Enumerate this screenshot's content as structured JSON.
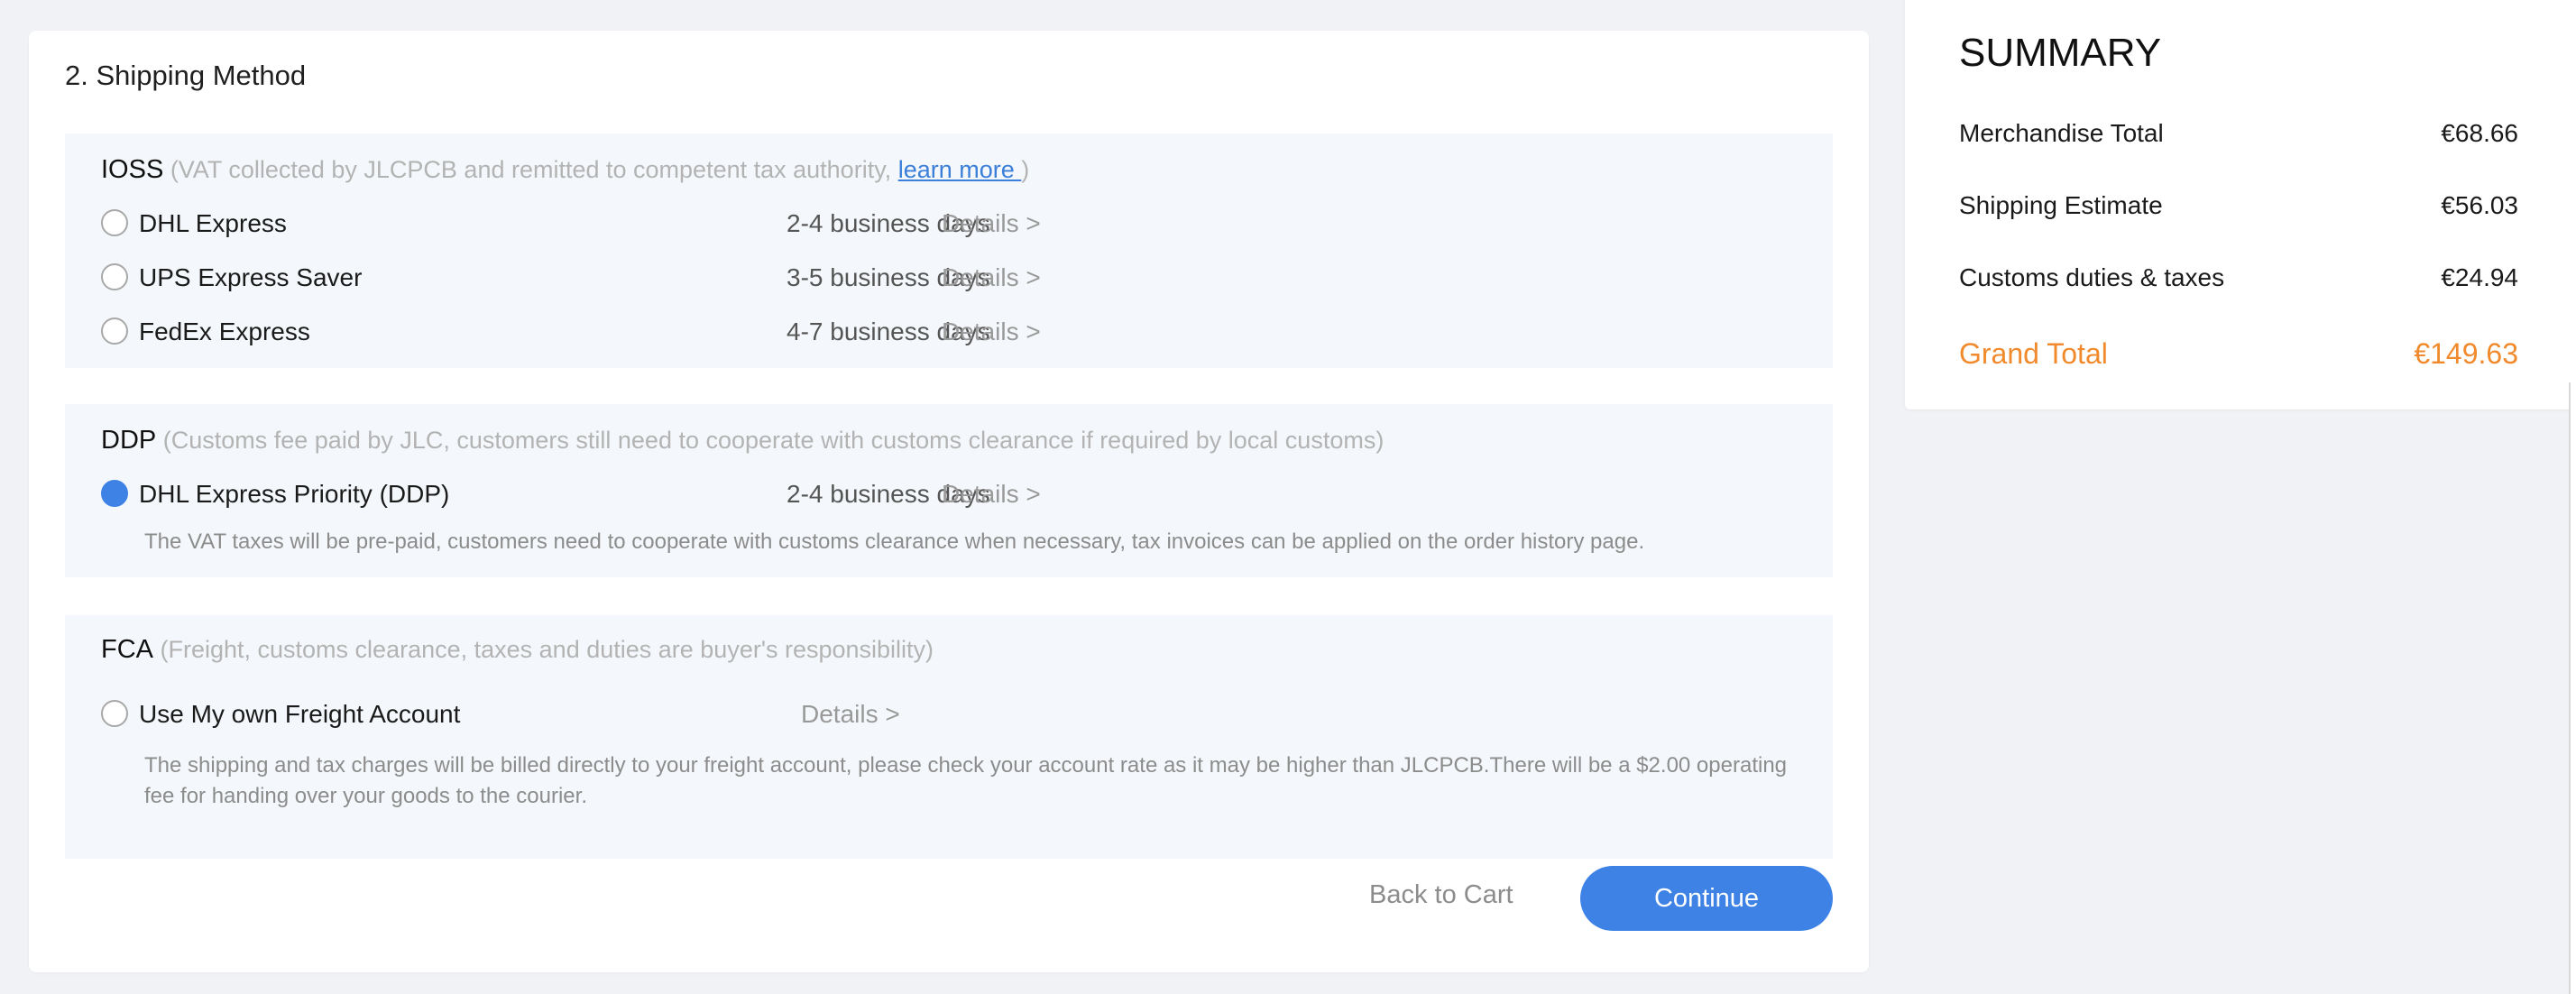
{
  "shipping": {
    "section_title": "2. Shipping Method",
    "ioss": {
      "code": "IOSS",
      "desc_before": " (VAT collected by JLCPCB and remitted to competent tax authority, ",
      "learn_more": "learn more ",
      "desc_after": ")",
      "options": [
        {
          "label": "DHL Express",
          "days": "2-4 business days",
          "details": "Details >"
        },
        {
          "label": "UPS Express Saver",
          "days": "3-5 business days",
          "details": "Details >"
        },
        {
          "label": "FedEx Express",
          "days": "4-7 business days",
          "details": "Details >"
        }
      ]
    },
    "ddp": {
      "code": "DDP",
      "desc": " (Customs fee paid by JLC, customers still need to cooperate with customs clearance if required by local customs)",
      "option": {
        "label": "DHL Express Priority (DDP)",
        "days": "2-4 business days",
        "details": "Details >",
        "selected": true
      },
      "note": "The VAT taxes will be pre-paid, customers need to cooperate with customs clearance when necessary, tax invoices can be applied on the order history page."
    },
    "fca": {
      "code": "FCA",
      "desc": " (Freight, customs clearance, taxes and duties are buyer's responsibility)",
      "option": {
        "label": "Use My own Freight Account",
        "details": "Details >"
      },
      "note_line1": "The shipping and tax charges will be billed directly to your freight account, please check your account rate as it may be higher than JLCPCB.There will be a $2.00 operating",
      "note_line2": "fee for handing over your goods to the courier."
    },
    "back_label": "Back to Cart",
    "continue_label": "Continue"
  },
  "summary": {
    "title": "SUMMARY",
    "rows": [
      {
        "label": "Merchandise Total",
        "value": "€68.66"
      },
      {
        "label": "Shipping Estimate",
        "value": "€56.03"
      },
      {
        "label": "Customs duties & taxes",
        "value": "€24.94"
      }
    ],
    "grand_label": "Grand Total",
    "grand_value": "€149.63"
  },
  "colors": {
    "accent": "#3d82e4",
    "grand_total": "#f08a2c"
  }
}
